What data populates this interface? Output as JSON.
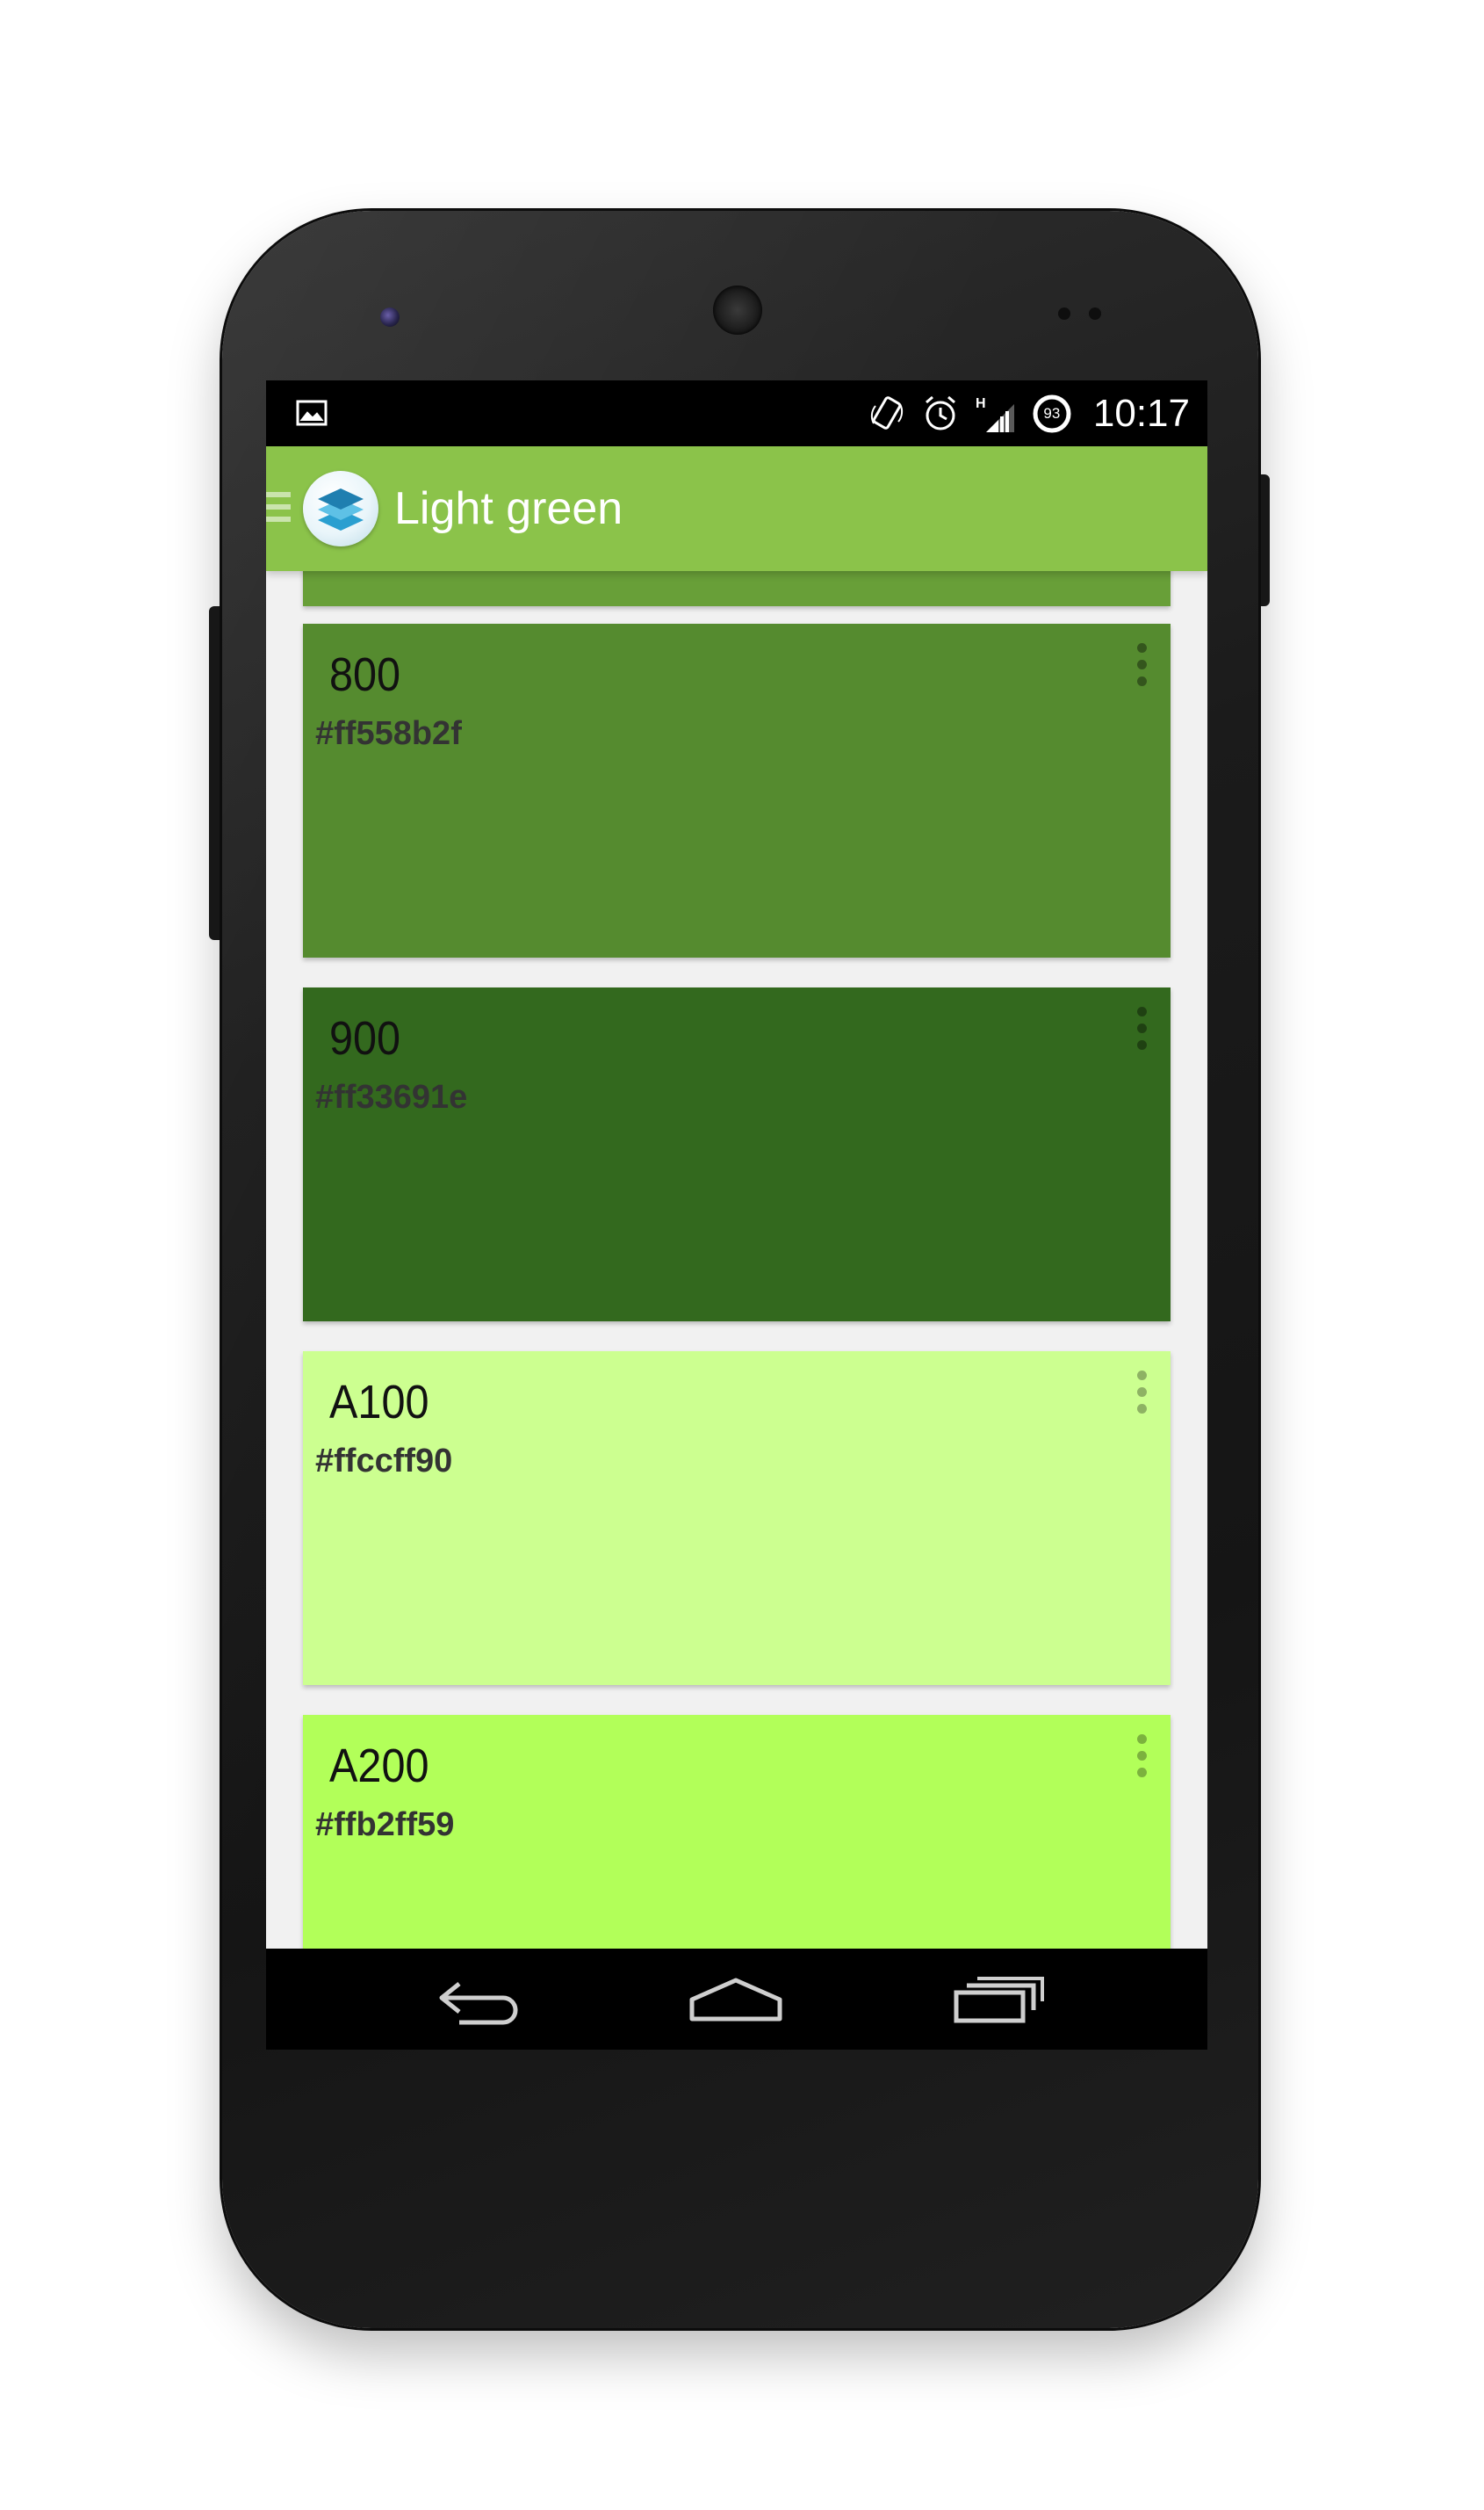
{
  "status_bar": {
    "icons": [
      "gallery-icon",
      "screen-rotation-icon",
      "alarm-icon",
      "signal-h-icon",
      "battery-circle-icon"
    ],
    "network_type": "H",
    "battery_level": "93",
    "time": "10:17"
  },
  "action_bar": {
    "title": "Light green",
    "background_color": "#8bc34a",
    "icons": [
      "drawer-menu-icon",
      "app-layers-logo-icon"
    ]
  },
  "swatches": [
    {
      "name": "",
      "hex": "",
      "color": "#689f38",
      "partial": true
    },
    {
      "name": "800",
      "hex": "#ff558b2f",
      "color": "#558b2f"
    },
    {
      "name": "900",
      "hex": "#ff33691e",
      "color": "#33691e"
    },
    {
      "name": "A100",
      "hex": "#ffccff90",
      "color": "#ccff90"
    },
    {
      "name": "A200",
      "hex": "#ffb2ff59",
      "color": "#b2ff59"
    }
  ],
  "nav_bar": {
    "buttons": [
      "back-icon",
      "home-icon",
      "recent-apps-icon"
    ]
  }
}
